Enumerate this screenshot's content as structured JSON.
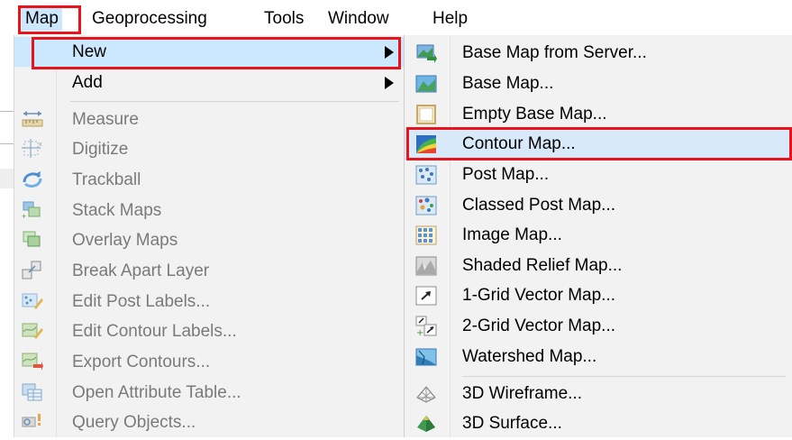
{
  "menubar": {
    "items": [
      "Map",
      "Geoprocessing",
      "Tools",
      "Window",
      "Help"
    ]
  },
  "map_menu": {
    "items": [
      {
        "label": "New",
        "icon": "none",
        "submenu": true,
        "disabled": false
      },
      {
        "label": "Add",
        "icon": "none",
        "submenu": true,
        "disabled": false
      },
      {
        "label": "Measure",
        "icon": "ruler-icon",
        "disabled": true
      },
      {
        "label": "Digitize",
        "icon": "digitize-icon",
        "disabled": true
      },
      {
        "label": "Trackball",
        "icon": "trackball-icon",
        "disabled": true
      },
      {
        "label": "Stack Maps",
        "icon": "stack-maps-icon",
        "disabled": true
      },
      {
        "label": "Overlay Maps",
        "icon": "overlay-maps-icon",
        "disabled": true
      },
      {
        "label": "Break Apart Layer",
        "icon": "break-apart-icon",
        "disabled": true
      },
      {
        "label": "Edit Post Labels...",
        "icon": "edit-post-labels-icon",
        "disabled": true
      },
      {
        "label": "Edit Contour Labels...",
        "icon": "edit-contour-labels-icon",
        "disabled": true
      },
      {
        "label": "Export Contours...",
        "icon": "export-contours-icon",
        "disabled": true
      },
      {
        "label": "Open Attribute Table...",
        "icon": "attribute-table-icon",
        "disabled": true
      },
      {
        "label": "Query Objects...",
        "icon": "query-objects-icon",
        "disabled": true
      }
    ]
  },
  "new_submenu": {
    "items": [
      {
        "label": "Base Map from Server...",
        "icon": "base-map-server-icon"
      },
      {
        "label": "Base Map...",
        "icon": "base-map-icon"
      },
      {
        "label": "Empty Base Map...",
        "icon": "empty-base-map-icon"
      },
      {
        "label": "Contour Map...",
        "icon": "contour-map-icon"
      },
      {
        "label": "Post Map...",
        "icon": "post-map-icon"
      },
      {
        "label": "Classed Post Map...",
        "icon": "classed-post-map-icon"
      },
      {
        "label": "Image Map...",
        "icon": "image-map-icon"
      },
      {
        "label": "Shaded Relief Map...",
        "icon": "shaded-relief-icon"
      },
      {
        "label": "1-Grid Vector Map...",
        "icon": "one-grid-vector-icon"
      },
      {
        "label": "2-Grid Vector Map...",
        "icon": "two-grid-vector-icon"
      },
      {
        "label": "Watershed Map...",
        "icon": "watershed-icon"
      },
      {
        "label": "3D Wireframe...",
        "icon": "wireframe-3d-icon"
      },
      {
        "label": "3D Surface...",
        "icon": "surface-3d-icon"
      }
    ]
  },
  "colors": {
    "highlight": "#cce8ff",
    "annotation_red": "#e8141c",
    "menu_bg": "#f2f2f2",
    "disabled_text": "#7a7a7a"
  }
}
